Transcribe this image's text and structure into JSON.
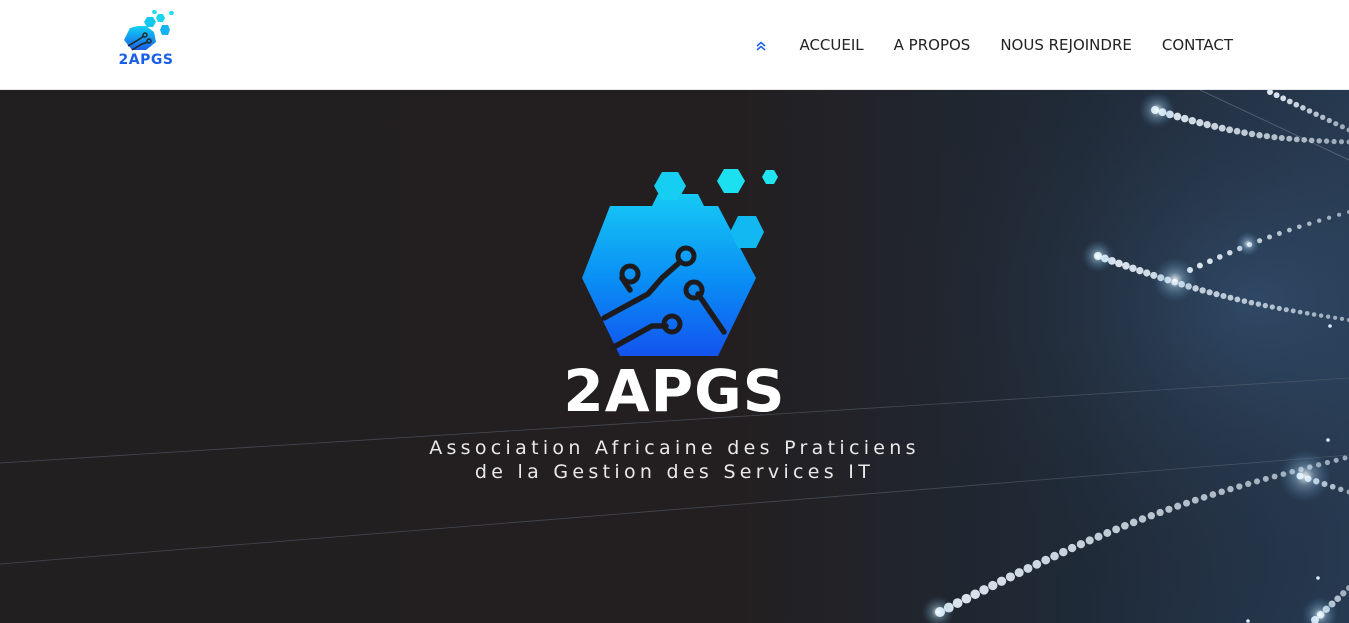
{
  "header": {
    "logo_text": "2APGS",
    "nav_icon": "double-chevron-up-icon",
    "nav": [
      {
        "label": "ACCUEIL"
      },
      {
        "label": "A PROPOS"
      },
      {
        "label": "NOUS REJOINDRE"
      },
      {
        "label": "CONTACT"
      }
    ]
  },
  "hero": {
    "acronym": "2APGS",
    "tagline_line1": "Association Africaine des Praticiens",
    "tagline_line2": "de la Gestion des Services IT"
  },
  "colors": {
    "brand_blue": "#1a5fe8",
    "brand_cyan": "#00e5f0",
    "hero_background": "#231f21",
    "nav_text": "#222222"
  }
}
